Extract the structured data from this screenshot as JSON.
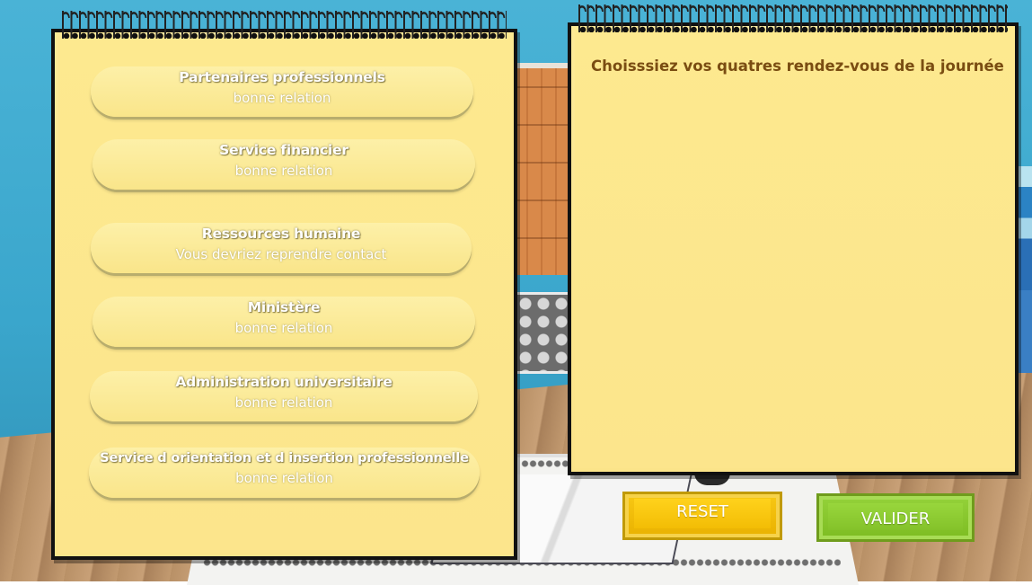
{
  "contacts": [
    {
      "title": "Partenaires professionnels",
      "status": "bonne relation"
    },
    {
      "title": "Service financier",
      "status": "bonne relation"
    },
    {
      "title": "Ressources humaine",
      "status": "Vous devriez reprendre contact"
    },
    {
      "title": "Ministère",
      "status": "bonne relation"
    },
    {
      "title": "Administration universitaire",
      "status": "bonne relation"
    },
    {
      "title": "Service d orientation et d insertion professionnelle",
      "status": "bonne relation"
    }
  ],
  "agenda": {
    "title": "Choisssiez vos quatres rendez-vous de la journée"
  },
  "buttons": {
    "reset_label": "RESET",
    "valider_label": "VALIDER"
  },
  "colors": {
    "notepad": "#fde990",
    "title_text": "#7a4d12",
    "reset": "#f3bd05",
    "valider": "#84c22a"
  }
}
